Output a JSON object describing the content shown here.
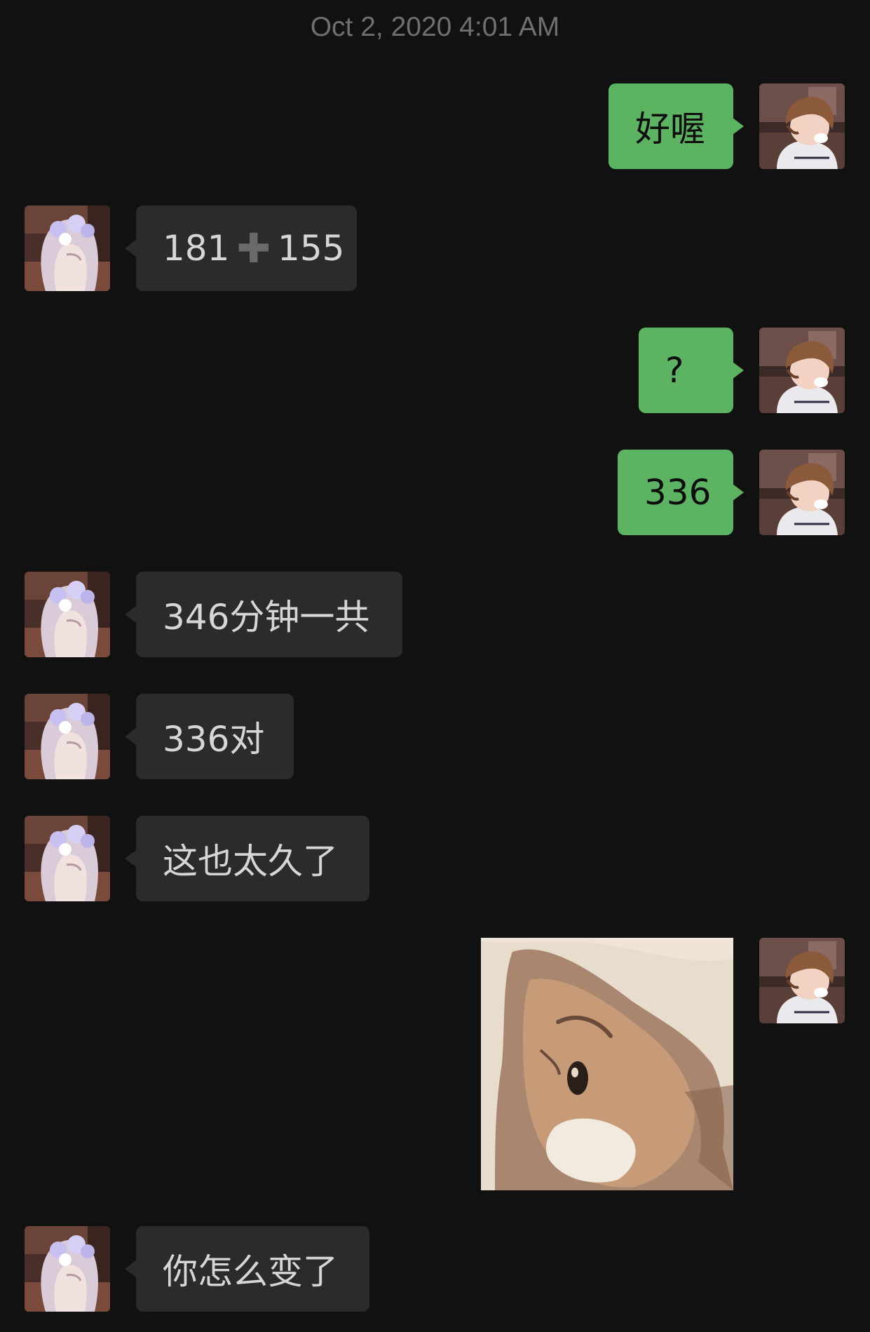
{
  "chat": {
    "timestamp": "Oct 2, 2020 4:01 AM",
    "messages": [
      {
        "side": "out",
        "text": "好喔"
      },
      {
        "side": "in",
        "left": "181",
        "operator": "➕",
        "right": "155"
      },
      {
        "side": "out",
        "text": "?"
      },
      {
        "side": "out",
        "text": "336"
      },
      {
        "side": "in",
        "text": "346分钟一共"
      },
      {
        "side": "in",
        "text": "336对"
      },
      {
        "side": "in",
        "text": "这也太久了"
      },
      {
        "side": "out",
        "type": "sticker",
        "sticker": "cat-sticker"
      },
      {
        "side": "in",
        "text": "你怎么变了"
      }
    ]
  },
  "icons": {
    "my_avatar": "anime-boy-avatar",
    "contact_avatar": "anime-girl-avatar",
    "plus": "plus-emoji"
  },
  "colors": {
    "background": "#111111",
    "outgoing_bubble": "#5cb463",
    "incoming_bubble": "#2b2b2b",
    "incoming_text": "#d6d6d6",
    "timestamp": "#6f6f6f"
  }
}
